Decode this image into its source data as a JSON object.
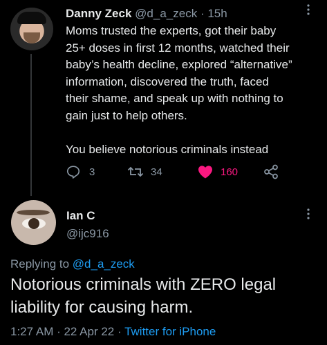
{
  "tweet": {
    "author_name": "Danny Zeck",
    "handle": "@d_a_zeck",
    "separator": "·",
    "age": "15h",
    "lines": [
      "Moms trusted the experts, got their baby",
      "25+ doses in first 12 months, watched their",
      "baby’s health decline, explored “alternative”",
      "information, discovered the truth, faced",
      "their shame, and speak up with nothing to",
      "gain just to help others."
    ],
    "closing_line": "You believe notorious criminals instead",
    "replies": "3",
    "retweets": "34",
    "likes": "160",
    "like_color": "#f91880"
  },
  "reply": {
    "author_name": "Ian C",
    "handle": "@ijc916",
    "replying_prefix": "Replying to ",
    "replying_handle": "@d_a_zeck",
    "text": "Notorious criminals with ZERO legal liability for causing harm.",
    "time": "1:27 AM · 22 Apr 22 · ",
    "source": "Twitter for iPhone",
    "link_color": "#1d9bf0"
  }
}
